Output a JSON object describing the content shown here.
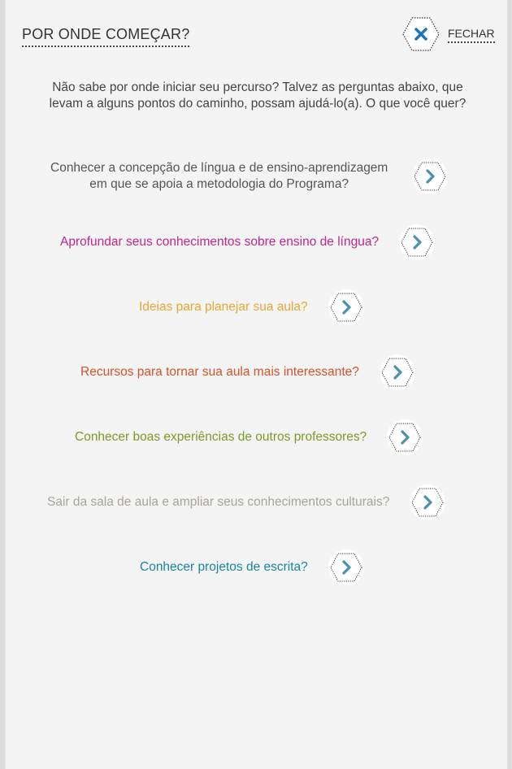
{
  "header": {
    "title": "POR ONDE COMEÇAR?",
    "close_label": "FECHAR"
  },
  "intro": {
    "line1": "Não sabe por onde iniciar seu percurso? Talvez as perguntas abaixo, que",
    "line2": "levam a alguns pontos do caminho, possam ajudá-lo(a). O que você quer?"
  },
  "options": [
    {
      "line1": "Conhecer a concepção de língua e de ensino-aprendizagem",
      "line2": "em que se apoia a metodologia do Programa?",
      "color": "#555555"
    },
    {
      "line1": "Aprofundar seus conhecimentos sobre ensino de língua?",
      "color": "#c0268c"
    },
    {
      "line1": "Ideias para planejar sua aula?",
      "color": "#e8a632"
    },
    {
      "line1": "Recursos para tornar sua aula mais interessante?",
      "color": "#d4532b"
    },
    {
      "line1": "Conhecer boas experiências de outros professores?",
      "color": "#7a9a2a"
    },
    {
      "line1": "Sair da sala de aula e ampliar seus conhecimentos culturais?",
      "color": "#a8a49a"
    },
    {
      "line1": "Conhecer projetos de escrita?",
      "color": "#17869e"
    }
  ],
  "icons": {
    "close": "close-icon",
    "option": "chevron-right-icon"
  },
  "colors": {
    "chevron": "#4a90b0",
    "close_x": "#1f78b4"
  }
}
